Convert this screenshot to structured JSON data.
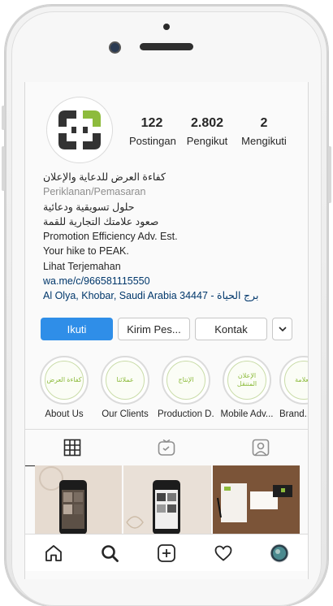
{
  "profile": {
    "stats": [
      {
        "value": "122",
        "label": "Postingan"
      },
      {
        "value": "2.802",
        "label": "Pengikut"
      },
      {
        "value": "2",
        "label": "Mengikuti"
      }
    ],
    "bio": {
      "name": "كفاءة العرض للدعاية والإعلان",
      "category": "Periklanan/Pemasaran",
      "line1": "حلول تسويقية ودعائية",
      "line2": "صعود علامتك التجارية للقمة",
      "line3": "Promotion Efficiency Adv. Est.",
      "line4": "Your hike to PEAK.",
      "translate": "Lihat Terjemahan",
      "link": "wa.me/c/966581115550",
      "address": "برج الحياة - Al Olya, Khobar, Saudi Arabia 34447"
    }
  },
  "actions": {
    "follow": "Ikuti",
    "message": "Kirim Pes...",
    "contact": "Kontak"
  },
  "highlights": [
    {
      "label": "About Us",
      "badge": "كفاءة العرض"
    },
    {
      "label": "Our Clients",
      "badge": "عملائنا"
    },
    {
      "label": "Production D...",
      "badge": "الإنتاج"
    },
    {
      "label": "Mobile Adv...",
      "badge": "الإعلان المتنقل"
    },
    {
      "label": "Brand...",
      "badge": "العلامة"
    }
  ],
  "colors": {
    "accent": "#2f8ee8",
    "brand_green": "#8dbb3c",
    "brand_dark": "#3a3a3a"
  }
}
